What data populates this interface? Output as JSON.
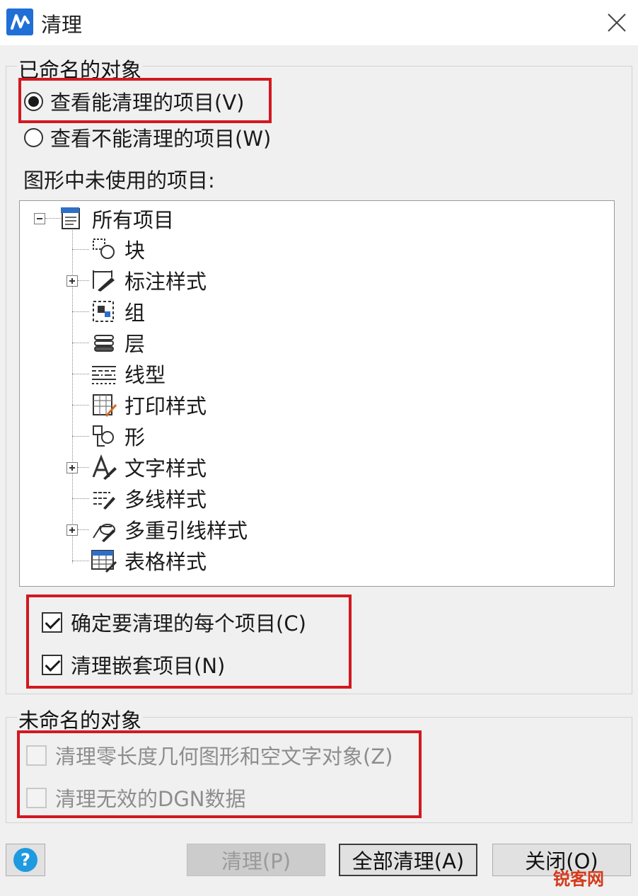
{
  "window": {
    "title": "清理"
  },
  "named_group": {
    "label": "已命名的对象",
    "radios": [
      {
        "label": "查看能清理的项目(V)",
        "checked": true
      },
      {
        "label": "查看不能清理的项目(W)",
        "checked": false
      }
    ],
    "unused_label": "图形中未使用的项目:"
  },
  "tree": {
    "root": "所有项目",
    "items": [
      {
        "label": "块",
        "icon": "block-icon",
        "expandable": false
      },
      {
        "label": "标注样式",
        "icon": "dimension-style-icon",
        "expandable": true
      },
      {
        "label": "组",
        "icon": "group-icon",
        "expandable": false
      },
      {
        "label": "层",
        "icon": "layer-icon",
        "expandable": false
      },
      {
        "label": "线型",
        "icon": "linetype-icon",
        "expandable": false
      },
      {
        "label": "打印样式",
        "icon": "plot-style-icon",
        "expandable": false
      },
      {
        "label": "形",
        "icon": "shape-icon",
        "expandable": false
      },
      {
        "label": "文字样式",
        "icon": "text-style-icon",
        "expandable": true
      },
      {
        "label": "多线样式",
        "icon": "multiline-style-icon",
        "expandable": false
      },
      {
        "label": "多重引线样式",
        "icon": "multileader-style-icon",
        "expandable": true
      },
      {
        "label": "表格样式",
        "icon": "table-style-icon",
        "expandable": false
      }
    ]
  },
  "named_options": [
    {
      "label": "确定要清理的每个项目(C)",
      "checked": true
    },
    {
      "label": "清理嵌套项目(N)",
      "checked": true
    }
  ],
  "unnamed_group": {
    "label": "未命名的对象",
    "options": [
      {
        "label": "清理零长度几何图形和空文字对象(Z)",
        "checked": false,
        "enabled": false
      },
      {
        "label": "清理无效的DGN数据",
        "checked": false,
        "enabled": false
      }
    ]
  },
  "buttons": {
    "purge": "清理(P)",
    "purge_all": "全部清理(A)",
    "close": "关闭(O)"
  },
  "watermark": "锐客网",
  "colors": {
    "highlight_box": "#d31820",
    "app_icon": "#1f6fd6",
    "help_icon": "#1e9ae0"
  }
}
